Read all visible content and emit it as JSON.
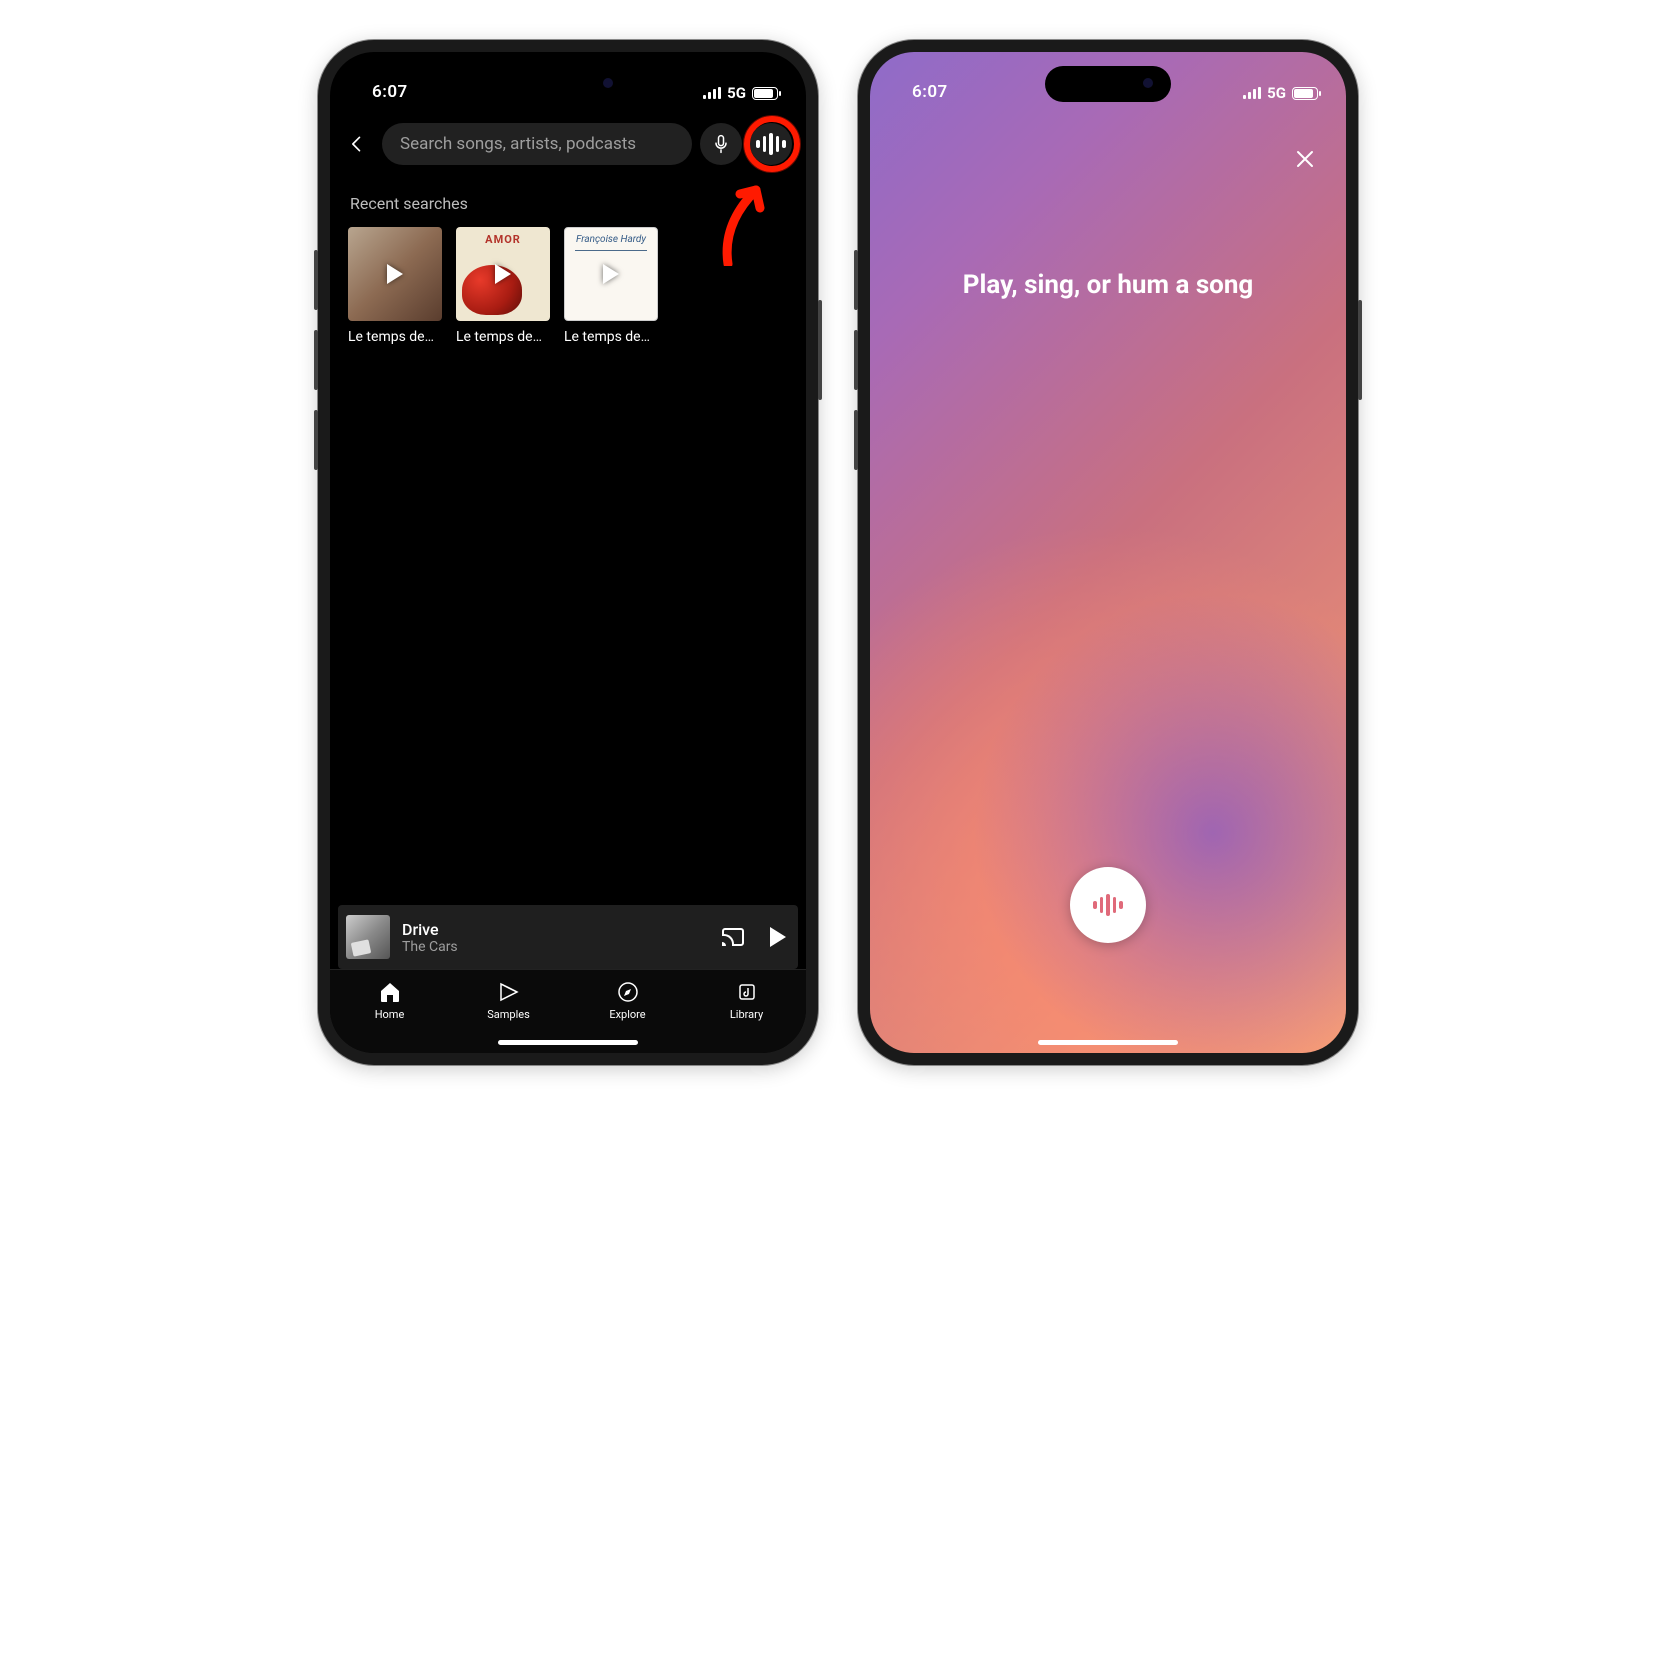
{
  "status": {
    "time": "6:07",
    "network": "5G"
  },
  "left": {
    "search": {
      "placeholder": "Search songs, artists, podcasts"
    },
    "recent_header": "Recent searches",
    "recent_items": [
      {
        "label": "Le temps de…"
      },
      {
        "label": "Le temps de…",
        "cover_text": "AMOR"
      },
      {
        "label": "Le temps de…",
        "cover_text": "Françoise Hardy"
      }
    ],
    "miniplayer": {
      "title": "Drive",
      "artist": "The Cars"
    },
    "tabs": [
      {
        "label": "Home"
      },
      {
        "label": "Samples"
      },
      {
        "label": "Explore"
      },
      {
        "label": "Library"
      }
    ]
  },
  "right": {
    "prompt": "Play, sing, or hum a song",
    "waveform_color": "#e06a7a"
  },
  "highlight": {
    "ring_color": "#ff1a00"
  }
}
